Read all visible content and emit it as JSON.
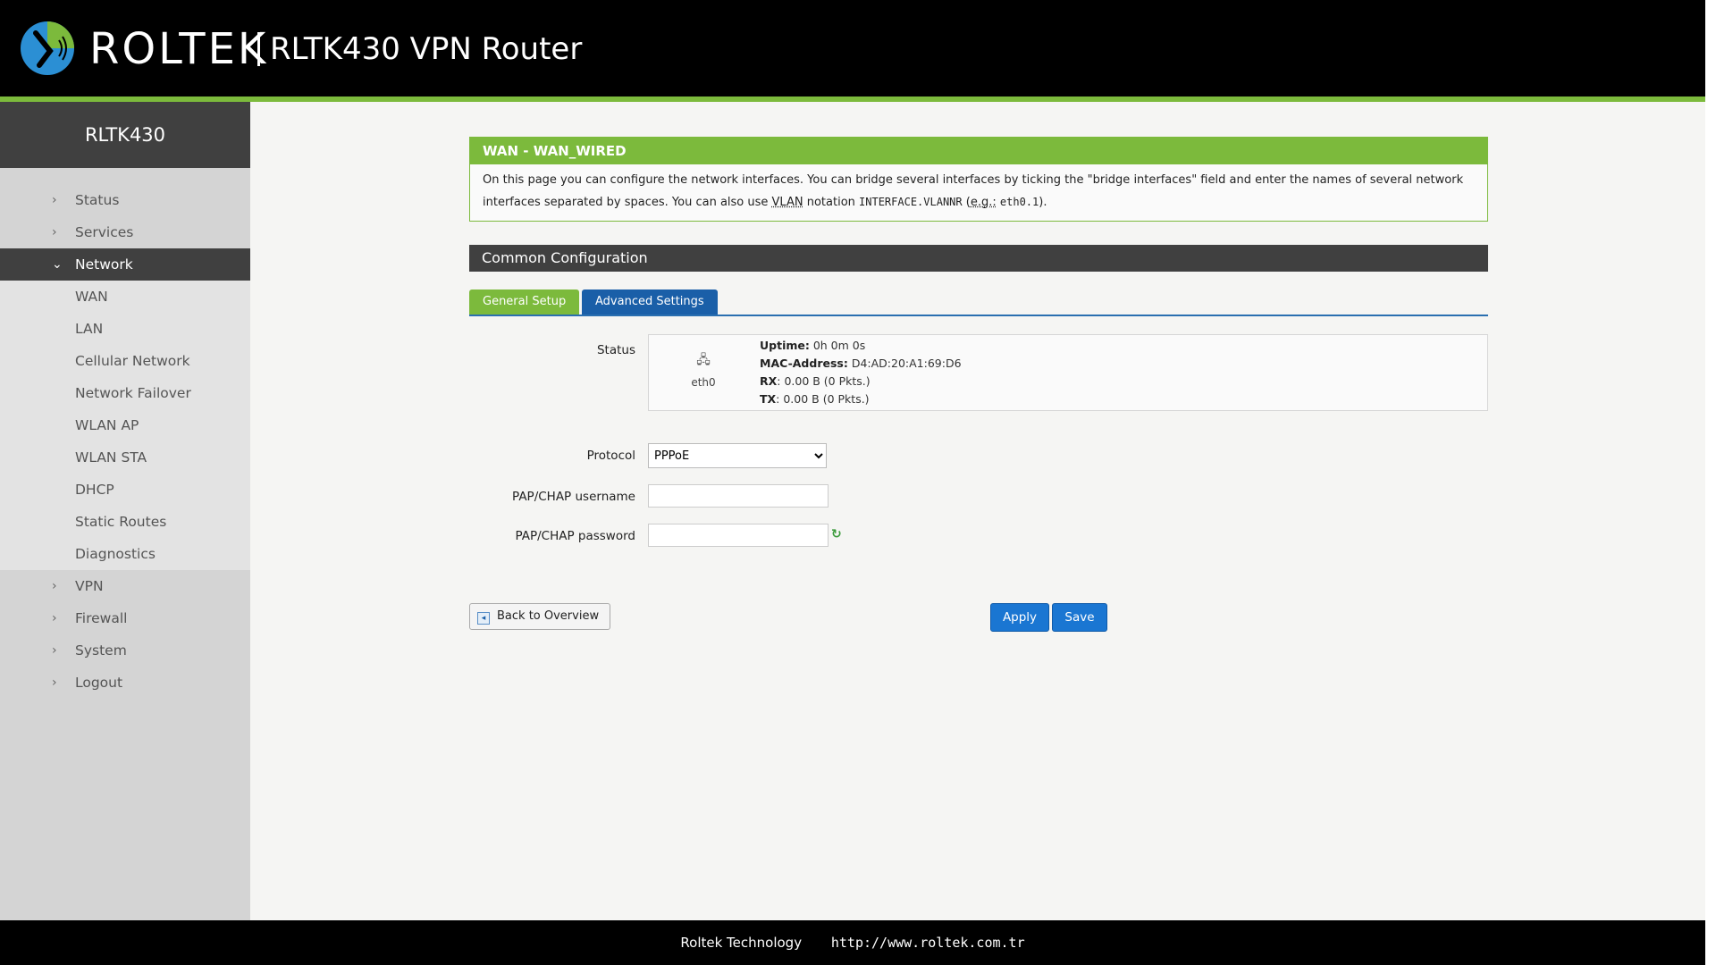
{
  "header": {
    "brand": "ROLTEK",
    "product": "RLTK430 VPN Router"
  },
  "sidebar": {
    "title": "RLTK430",
    "items": [
      {
        "label": "Status"
      },
      {
        "label": "Services"
      },
      {
        "label": "Network"
      },
      {
        "label": "VPN"
      },
      {
        "label": "Firewall"
      },
      {
        "label": "System"
      },
      {
        "label": "Logout"
      }
    ],
    "network_sub": [
      {
        "label": "WAN"
      },
      {
        "label": "LAN"
      },
      {
        "label": "Cellular Network"
      },
      {
        "label": "Network Failover"
      },
      {
        "label": "WLAN AP"
      },
      {
        "label": "WLAN STA"
      },
      {
        "label": "DHCP"
      },
      {
        "label": "Static Routes"
      },
      {
        "label": "Diagnostics"
      }
    ]
  },
  "notice": {
    "title": "WAN - WAN_WIRED",
    "text_1": "On this page you can configure the network interfaces. You can bridge several interfaces by ticking the \"bridge interfaces\" field and enter the names of several network interfaces separated by spaces. You can also use ",
    "vlan": "VLAN",
    "text_2": " notation ",
    "code_1": "INTERFACE.VLANNR",
    "text_3": " (",
    "eg": "e.g.:",
    "code_2": "eth0.1",
    "text_4": ")."
  },
  "section": {
    "title": "Common Configuration"
  },
  "tabs": {
    "general": "General Setup",
    "advanced": "Advanced Settings"
  },
  "form": {
    "status_label": "Status",
    "iface_name": "eth0",
    "uptime_label": "Uptime:",
    "uptime_value": " 0h 0m 0s",
    "mac_label": "MAC-Address:",
    "mac_value": " D4:AD:20:A1:69:D6",
    "rx_label": "RX",
    "rx_value": ": 0.00 B (0 Pkts.)",
    "tx_label": "TX",
    "tx_value": ": 0.00 B (0 Pkts.)",
    "protocol_label": "Protocol",
    "protocol_value": "PPPoE",
    "username_label": "PAP/CHAP username",
    "username_value": "",
    "password_label": "PAP/CHAP password",
    "password_value": ""
  },
  "actions": {
    "back": "Back to Overview",
    "apply": "Apply",
    "save": "Save"
  },
  "footer": {
    "company": "Roltek Technology",
    "url": "http://www.roltek.com.tr"
  },
  "colors": {
    "accent_green": "#7cba3c",
    "primary_blue": "#1a76d2",
    "dark": "#404040"
  }
}
